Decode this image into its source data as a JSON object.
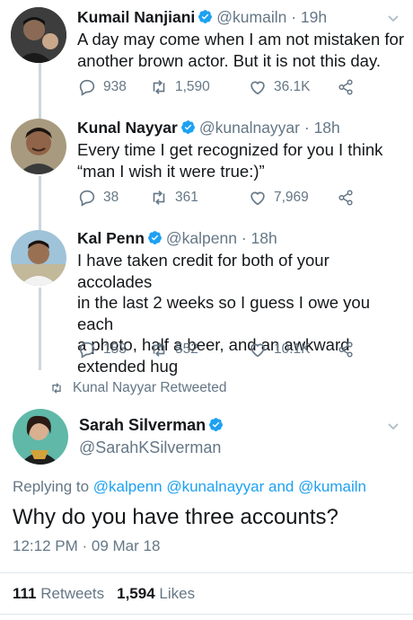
{
  "colors": {
    "accent": "#1da1f2",
    "text_primary": "#14171a",
    "text_secondary": "#657786",
    "thread_line": "#ccd6dd"
  },
  "tweets": [
    {
      "name": "Kumail Nanjiani",
      "handle": "@kumailn",
      "time": "· 19h",
      "text_lines": [
        "A day may come when I am not mistaken for",
        "another brown actor. But it is not this day."
      ],
      "replies": "938",
      "retweets": "1,590",
      "likes": "36.1K"
    },
    {
      "name": "Kunal Nayyar",
      "handle": "@kunalnayyar",
      "time": "· 18h",
      "text_lines": [
        "Every time I get recognized for you I think",
        "“man I wish it were true:)”"
      ],
      "replies": "38",
      "retweets": "361",
      "likes": "7,969"
    },
    {
      "name": "Kal Penn",
      "handle": "@kalpenn",
      "time": "· 18h",
      "text_lines": [
        "I have taken credit for both of your accolades",
        "in the last 2 weeks so I guess I owe you each",
        "a photo, half a beer, and an awkward",
        "extended hug"
      ],
      "replies": "153",
      "retweets": "552",
      "likes": "10.1K"
    }
  ],
  "retweet_notice": "Kunal Nayyar Retweeted",
  "main_tweet": {
    "name": "Sarah Silverman",
    "handle": "@SarahKSilverman",
    "replying_prefix": "Replying to",
    "replying_to": [
      "@kalpenn",
      "@kunalnayyar",
      "and",
      "@kumailn"
    ],
    "text": "Why do you have three accounts?",
    "timestamp": "12:12 PM · 09 Mar 18",
    "retweets_count": "111",
    "retweets_label": "Retweets",
    "likes_count": "1,594",
    "likes_label": "Likes"
  }
}
